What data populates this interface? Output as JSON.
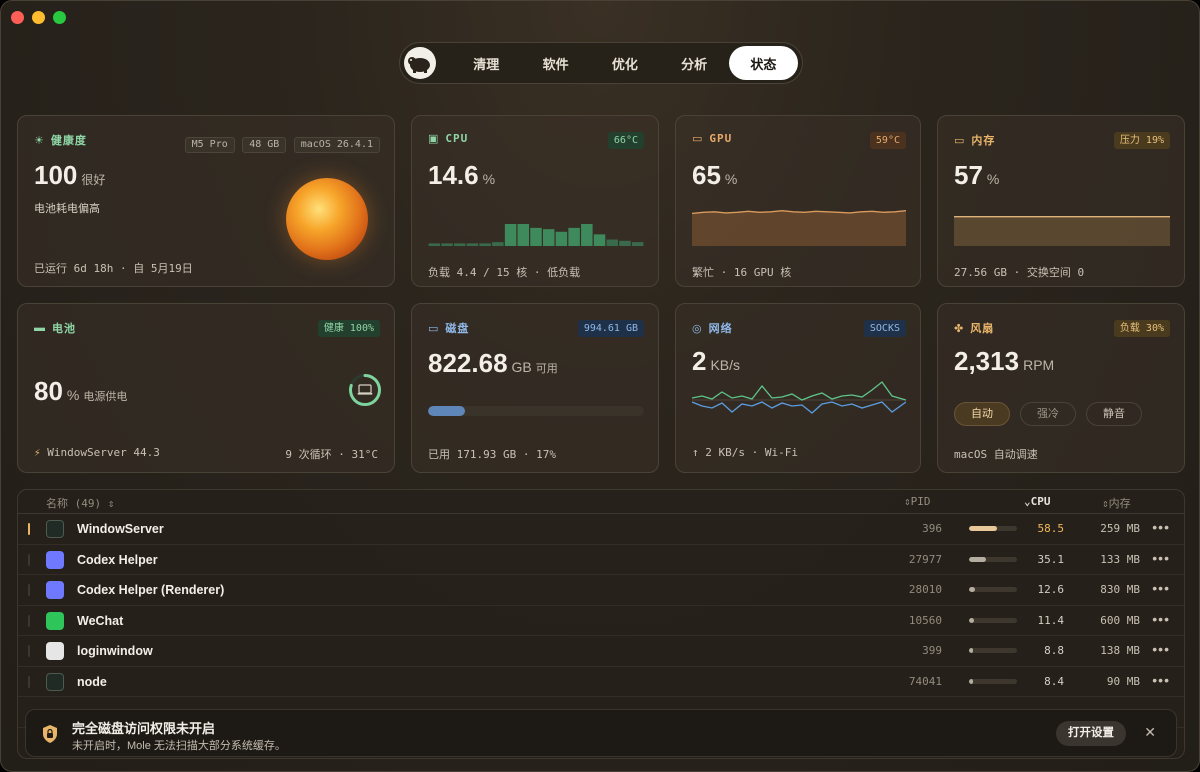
{
  "window": {
    "traffic": [
      "#ff5f57",
      "#febc2e",
      "#28c840"
    ]
  },
  "nav": {
    "tabs": [
      {
        "label": "清理",
        "active": false
      },
      {
        "label": "软件",
        "active": false
      },
      {
        "label": "优化",
        "active": false
      },
      {
        "label": "分析",
        "active": false
      },
      {
        "label": "状态",
        "active": true
      }
    ]
  },
  "health": {
    "title": "健康度",
    "chips": [
      "M5 Pro",
      "48 GB",
      "macOS 26.4.1"
    ],
    "score": "100",
    "rating": "很好",
    "note": "电池耗电偏高",
    "uptime": "已运行 6d 18h · 自 5月19日"
  },
  "cpu": {
    "title": "CPU",
    "temp": "66°C",
    "value": "14.6",
    "unit": "%",
    "footer": "负载 4.4 / 15 核 · 低负载",
    "bars": [
      2,
      2,
      2,
      2,
      2,
      3,
      17,
      17,
      14,
      13,
      11,
      14,
      17,
      9,
      5,
      4,
      3
    ]
  },
  "gpu": {
    "title": "GPU",
    "temp": "59°C",
    "value": "65",
    "unit": "%",
    "footer": "繁忙 · 16 GPU 核",
    "series": [
      60,
      62,
      63,
      61,
      62,
      64,
      62,
      63,
      65,
      63,
      62,
      64,
      63,
      62,
      61,
      63,
      64,
      62,
      63,
      65
    ]
  },
  "memory": {
    "title": "内存",
    "pressure": "压力 19%",
    "value": "57",
    "unit": "%",
    "footer": "27.56 GB · 交换空间 0",
    "series": [
      57,
      57,
      57,
      57,
      57,
      57,
      57,
      57,
      57,
      57,
      57,
      57
    ]
  },
  "battery": {
    "title": "电池",
    "health": "健康 100%",
    "value": "80",
    "unit": "%",
    "source": "电源供电",
    "top_app": "WindowServer 44.3",
    "cycles": "9 次循环 · 31°C",
    "level": 0.8
  },
  "disk": {
    "title": "磁盘",
    "total": "994.61 GB",
    "value": "822.68",
    "unit": "GB",
    "avail": "可用",
    "used": "已用 171.93 GB · 17%",
    "used_fraction": 0.17
  },
  "network": {
    "title": "网络",
    "proxy": "SOCKS",
    "value": "2",
    "unit": "KB/s",
    "footer": "↑ 2 KB/s · Wi-Fi"
  },
  "fan": {
    "title": "风扇",
    "load": "负载 30%",
    "value": "2,313",
    "unit": "RPM",
    "modes": [
      {
        "label": "自动",
        "active": true
      },
      {
        "label": "强冷",
        "active": false
      },
      {
        "label": "静音",
        "active": false
      }
    ],
    "footer": "macOS 自动调速"
  },
  "table": {
    "col_name": "名称 (49)",
    "col_pid": "PID",
    "col_cpu": "CPU",
    "col_mem": "内存",
    "rows": [
      {
        "name": "WindowServer",
        "pid": "396",
        "cpu": "58.5",
        "mem": "259 MB",
        "load": 0.585,
        "hot": true,
        "icon": "terminal-icon",
        "color": "#1f2b24"
      },
      {
        "name": "Codex Helper",
        "pid": "27977",
        "cpu": "35.1",
        "mem": "133 MB",
        "load": 0.351,
        "hot": false,
        "icon": "codex-icon",
        "color": "#6f79ff"
      },
      {
        "name": "Codex Helper (Renderer)",
        "pid": "28010",
        "cpu": "12.6",
        "mem": "830 MB",
        "load": 0.126,
        "hot": false,
        "icon": "codex-icon",
        "color": "#6f79ff"
      },
      {
        "name": "WeChat",
        "pid": "10560",
        "cpu": "11.4",
        "mem": "600 MB",
        "load": 0.114,
        "hot": false,
        "icon": "wechat-icon",
        "color": "#2ec55a"
      },
      {
        "name": "loginwindow",
        "pid": "399",
        "cpu": "8.8",
        "mem": "138 MB",
        "load": 0.088,
        "hot": false,
        "icon": "generic-app-icon",
        "color": "#e6e6e6"
      },
      {
        "name": "node",
        "pid": "74041",
        "cpu": "8.4",
        "mem": "90 MB",
        "load": 0.084,
        "hot": false,
        "icon": "terminal-icon",
        "color": "#1f2b24"
      }
    ]
  },
  "toast": {
    "title": "完全磁盘访问权限未开启",
    "subtitle": "未开启时，Mole 无法扫描大部分系统缓存。",
    "button": "打开设置"
  }
}
